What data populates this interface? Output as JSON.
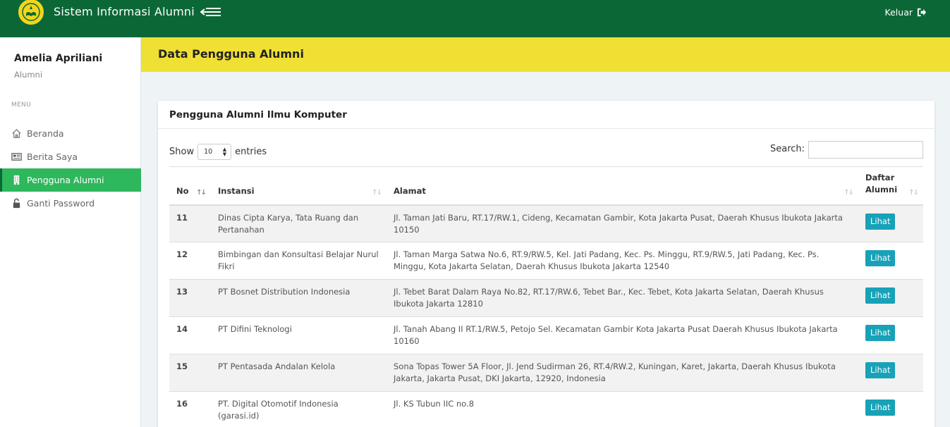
{
  "app": {
    "title": "Sistem Informasi Alumni",
    "logout_label": "Keluar"
  },
  "user": {
    "name": "Amelia Apriliani",
    "role": "Alumni"
  },
  "sidebar": {
    "menu_header": "MENU",
    "items": [
      {
        "label": "Beranda",
        "icon": "home-icon",
        "active": false
      },
      {
        "label": "Berita Saya",
        "icon": "newspaper-icon",
        "active": false
      },
      {
        "label": "Pengguna Alumni",
        "icon": "building-icon",
        "active": true
      },
      {
        "label": "Ganti Password",
        "icon": "unlock-icon",
        "active": false
      }
    ]
  },
  "page": {
    "title": "Data Pengguna Alumni"
  },
  "card": {
    "title": "Pengguna Alumni Ilmu Komputer",
    "show_label": "Show",
    "entries_value": "10",
    "entries_label": "entries",
    "search_label": "Search:",
    "search_value": ""
  },
  "table": {
    "columns": [
      "No",
      "Instansi",
      "Alamat",
      "Daftar Alumni"
    ],
    "action_label": "Lihat",
    "rows": [
      {
        "no": "11",
        "instansi": "Dinas Cipta Karya, Tata Ruang dan Pertanahan",
        "alamat": "Jl. Taman Jati Baru, RT.17/RW.1, Cideng, Kecamatan Gambir, Kota Jakarta Pusat, Daerah Khusus Ibukota Jakarta 10150"
      },
      {
        "no": "12",
        "instansi": "Bimbingan dan Konsultasi Belajar Nurul Fikri",
        "alamat": "Jl. Taman Marga Satwa No.6, RT.9/RW.5, Kel. Jati Padang, Kec. Ps. Minggu, RT.9/RW.5, Jati Padang, Kec. Ps. Minggu, Kota Jakarta Selatan, Daerah Khusus Ibukota Jakarta 12540"
      },
      {
        "no": "13",
        "instansi": "PT Bosnet Distribution Indonesia",
        "alamat": "Jl. Tebet Barat Dalam Raya No.82, RT.17/RW.6, Tebet Bar., Kec. Tebet, Kota Jakarta Selatan, Daerah Khusus Ibukota Jakarta 12810"
      },
      {
        "no": "14",
        "instansi": "PT Difini Teknologi",
        "alamat": "Jl. Tanah Abang II RT.1/RW.5, Petojo Sel. Kecamatan Gambir Kota Jakarta Pusat Daerah Khusus Ibukota Jakarta 10160"
      },
      {
        "no": "15",
        "instansi": "PT Pentasada Andalan Kelola",
        "alamat": "Sona Topas Tower 5A Floor, Jl. Jend Sudirman 26, RT.4/RW.2, Kuningan, Karet, Jakarta, Daerah Khusus Ibukota Jakarta, Jakarta Pusat, DKI Jakarta, 12920, Indonesia"
      },
      {
        "no": "16",
        "instansi": "PT. Digital Otomotif Indonesia (garasi.id)",
        "alamat": "Jl. KS Tubun IIC no.8"
      }
    ]
  },
  "colors": {
    "topbar": "#0b6836",
    "header_band": "#f0e033",
    "active_menu": "#2eb75c",
    "button": "#17a2b8"
  }
}
